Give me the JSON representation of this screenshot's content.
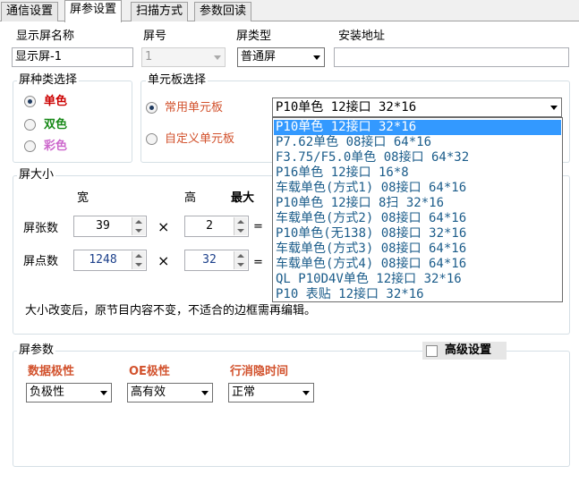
{
  "tabs": [
    {
      "label": "通信设置"
    },
    {
      "label": "屏参设置"
    },
    {
      "label": "扫描方式"
    },
    {
      "label": "参数回读"
    }
  ],
  "screen": {
    "name_label": "显示屏名称",
    "name_value": "显示屏-1",
    "number_label": "屏号",
    "number_value": "1",
    "type_label": "屏类型",
    "type_value": "普通屏",
    "address_label": "安装地址",
    "address_value": ""
  },
  "color_type": {
    "title": "屏种类选择",
    "options": [
      {
        "label": "单色",
        "color": "#cc0000",
        "selected": true
      },
      {
        "label": "双色",
        "color": "#1a8a1a",
        "selected": false
      },
      {
        "label": "彩色",
        "color": "#cc66cc",
        "selected": false
      }
    ]
  },
  "unit_board": {
    "title": "单元板选择",
    "common_label": "常用单元板",
    "custom_label": "自定义单元板",
    "selected_value": "P10单色 12接口 32*16",
    "options": [
      "P10单色 12接口 32*16",
      "P7.62单色 08接口 64*16",
      "F3.75/F5.0单色 08接口 64*32",
      "P16单色 12接口 16*8",
      "车载单色(方式1) 08接口 64*16",
      "P10单色 12接口 8扫 32*16",
      "车载单色(方式2) 08接口 64*16",
      "P10单色(无138) 08接口 32*16",
      "车载单色(方式3) 08接口 64*16",
      "车载单色(方式4) 08接口 64*16",
      "QL P10D4V单色 12接口 32*16",
      "P10 表贴 12接口 32*16"
    ],
    "highlight_color": "#3399ff",
    "item_color": "#1b5c8a"
  },
  "size": {
    "title": "屏大小",
    "col_width": "宽",
    "col_height": "高",
    "col_max": "最大",
    "row_boards_label": "屏张数",
    "boards_width": "39",
    "boards_height": "2",
    "row_pixels_label": "屏点数",
    "pixels_width": "1248",
    "pixels_height": "32",
    "times": "×",
    "equals": "=",
    "note": "大小改变后，原节目内容不变，不适合的边框需再编辑。"
  },
  "params": {
    "title": "屏参数",
    "advanced_label": "高级设置",
    "data_polarity_label": "数据极性",
    "data_polarity_value": "负极性",
    "oe_polarity_label": "OE极性",
    "oe_polarity_value": "高有效",
    "blanking_label": "行消隐时间",
    "blanking_value": "正常",
    "label_color": "#d2522d"
  }
}
